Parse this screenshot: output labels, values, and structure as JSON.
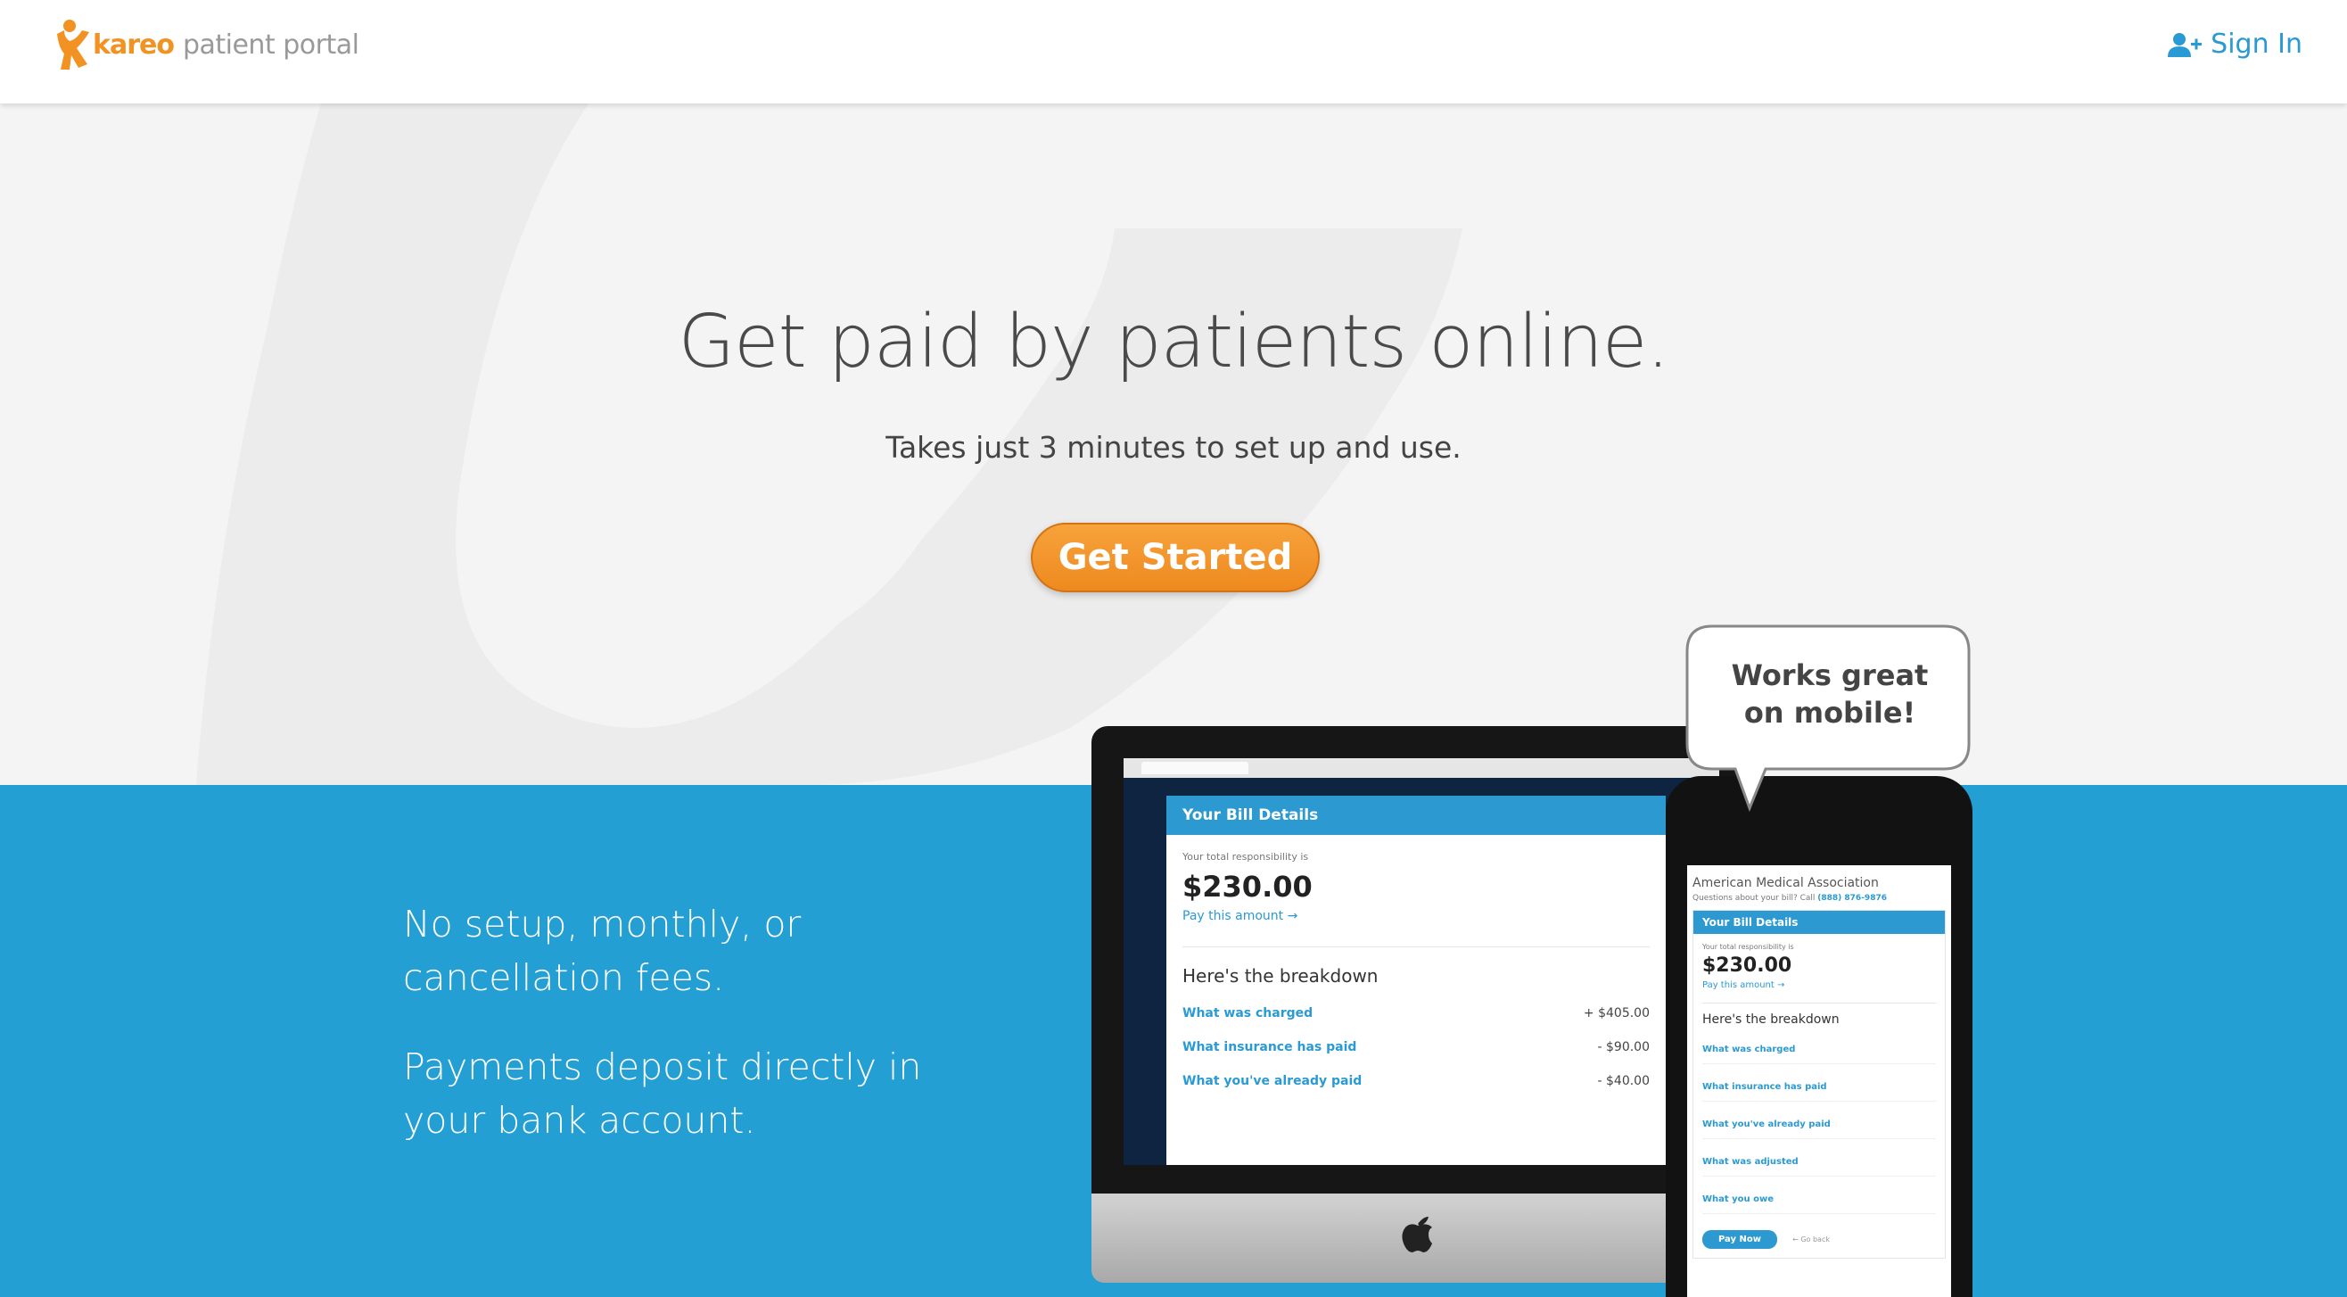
{
  "header": {
    "brand": "kareo",
    "product": "patient portal",
    "signin_label": "Sign In"
  },
  "hero": {
    "title": "Get paid by patients online.",
    "subtitle": "Takes just 3 minutes to set up and use.",
    "cta_label": "Get Started"
  },
  "features": {
    "item1": "No setup, monthly, or cancellation fees.",
    "item2": "Payments deposit directly in your bank account."
  },
  "desktop_preview": {
    "header": "Your Bill Details",
    "responsibility_label": "Your total responsibility is",
    "amount": "$230.00",
    "pay_link": "Pay this amount →",
    "breakdown_title": "Here's the breakdown",
    "rows": [
      {
        "label": "What was charged",
        "value": "+ $405.00"
      },
      {
        "label": "What insurance has paid",
        "value": "- $90.00"
      },
      {
        "label": "What you've already paid",
        "value": "- $40.00"
      }
    ]
  },
  "mobile_preview": {
    "org": "American Medical Association",
    "question": "Questions about your bill? Call",
    "phone": "(888) 876-9876",
    "header": "Your Bill Details",
    "responsibility_label": "Your total responsibility is",
    "amount": "$230.00",
    "pay_link": "Pay this amount →",
    "breakdown_title": "Here's the breakdown",
    "items": [
      "What was charged",
      "What insurance has paid",
      "What you've already paid",
      "What was adjusted",
      "What you owe"
    ],
    "pay_button": "Pay Now",
    "back_link": "← Go back"
  },
  "bubble": {
    "line1": "Works great",
    "line2": "on mobile!"
  },
  "colors": {
    "accent_orange": "#f29223",
    "link_blue": "#2a9ad4",
    "band_blue": "#239fd3"
  }
}
